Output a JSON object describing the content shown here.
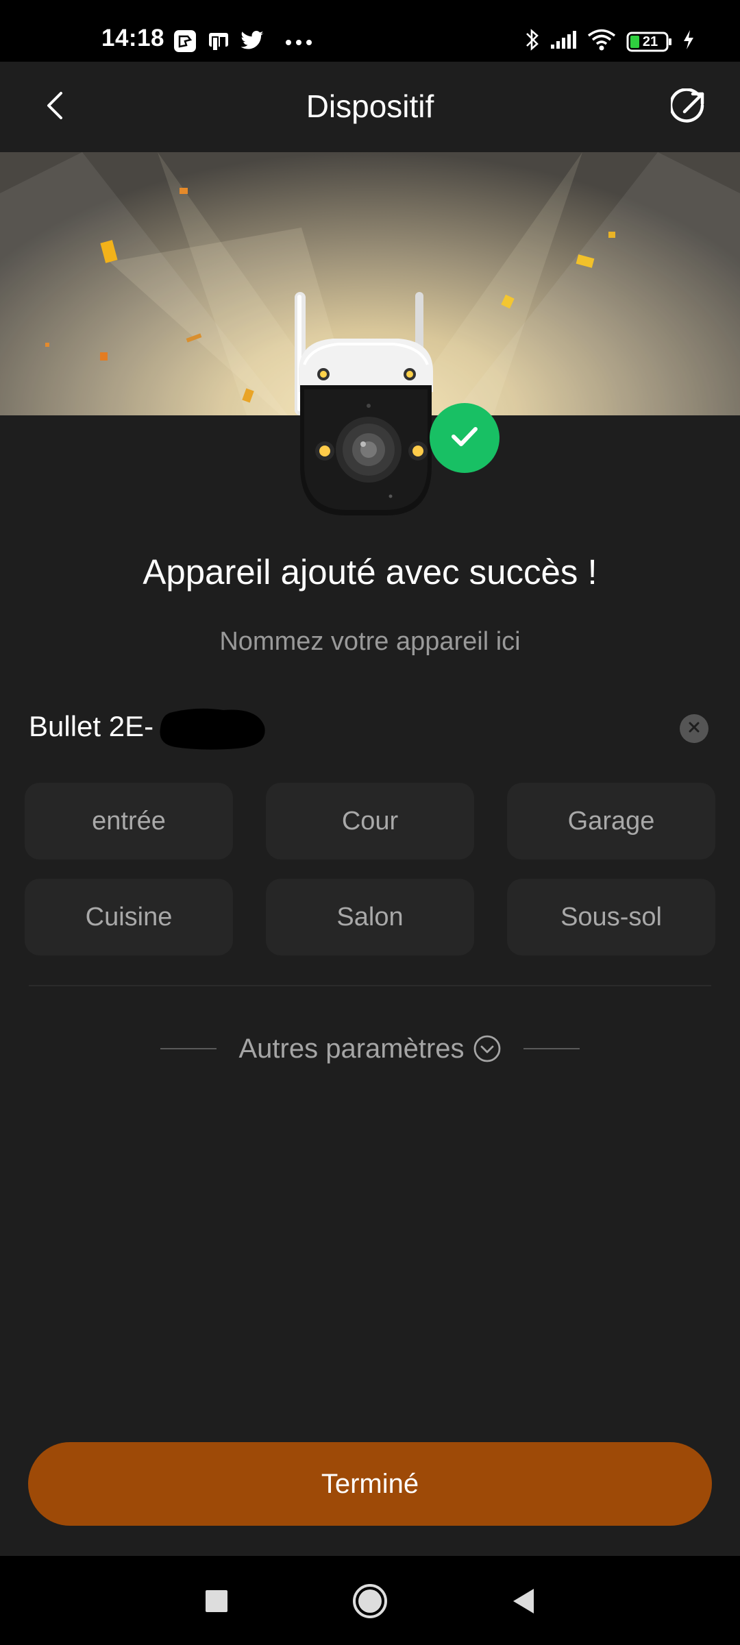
{
  "status_bar": {
    "time": "14:18",
    "battery": "21",
    "icons": [
      "notification-icon",
      "app-icon",
      "twitter-icon",
      "more-dots-icon",
      "bluetooth-icon",
      "signal-icon",
      "wifi-icon",
      "battery-icon",
      "charging-icon"
    ]
  },
  "header": {
    "title": "Dispositif",
    "back_icon": "chevron-left-icon",
    "share_icon": "share-icon"
  },
  "hero": {
    "image": "security-camera",
    "badge_icon": "check-icon",
    "badge_color": "#18c064"
  },
  "main": {
    "success_title": "Appareil ajouté avec succès !",
    "name_prompt": "Nommez votre appareil ici",
    "device_name": "Bullet 2E-",
    "clear_icon": "close-icon",
    "suggestions": [
      "entrée",
      "Cour",
      "Garage",
      "Cuisine",
      "Salon",
      "Sous-sol"
    ],
    "more_settings": "Autres paramètres",
    "more_settings_icon": "chevron-down-circle-icon"
  },
  "footer": {
    "done_label": "Terminé",
    "done_color": "#9e4a07"
  },
  "nav_bar": {
    "icons": [
      "recents-icon",
      "home-icon",
      "back-icon"
    ]
  }
}
